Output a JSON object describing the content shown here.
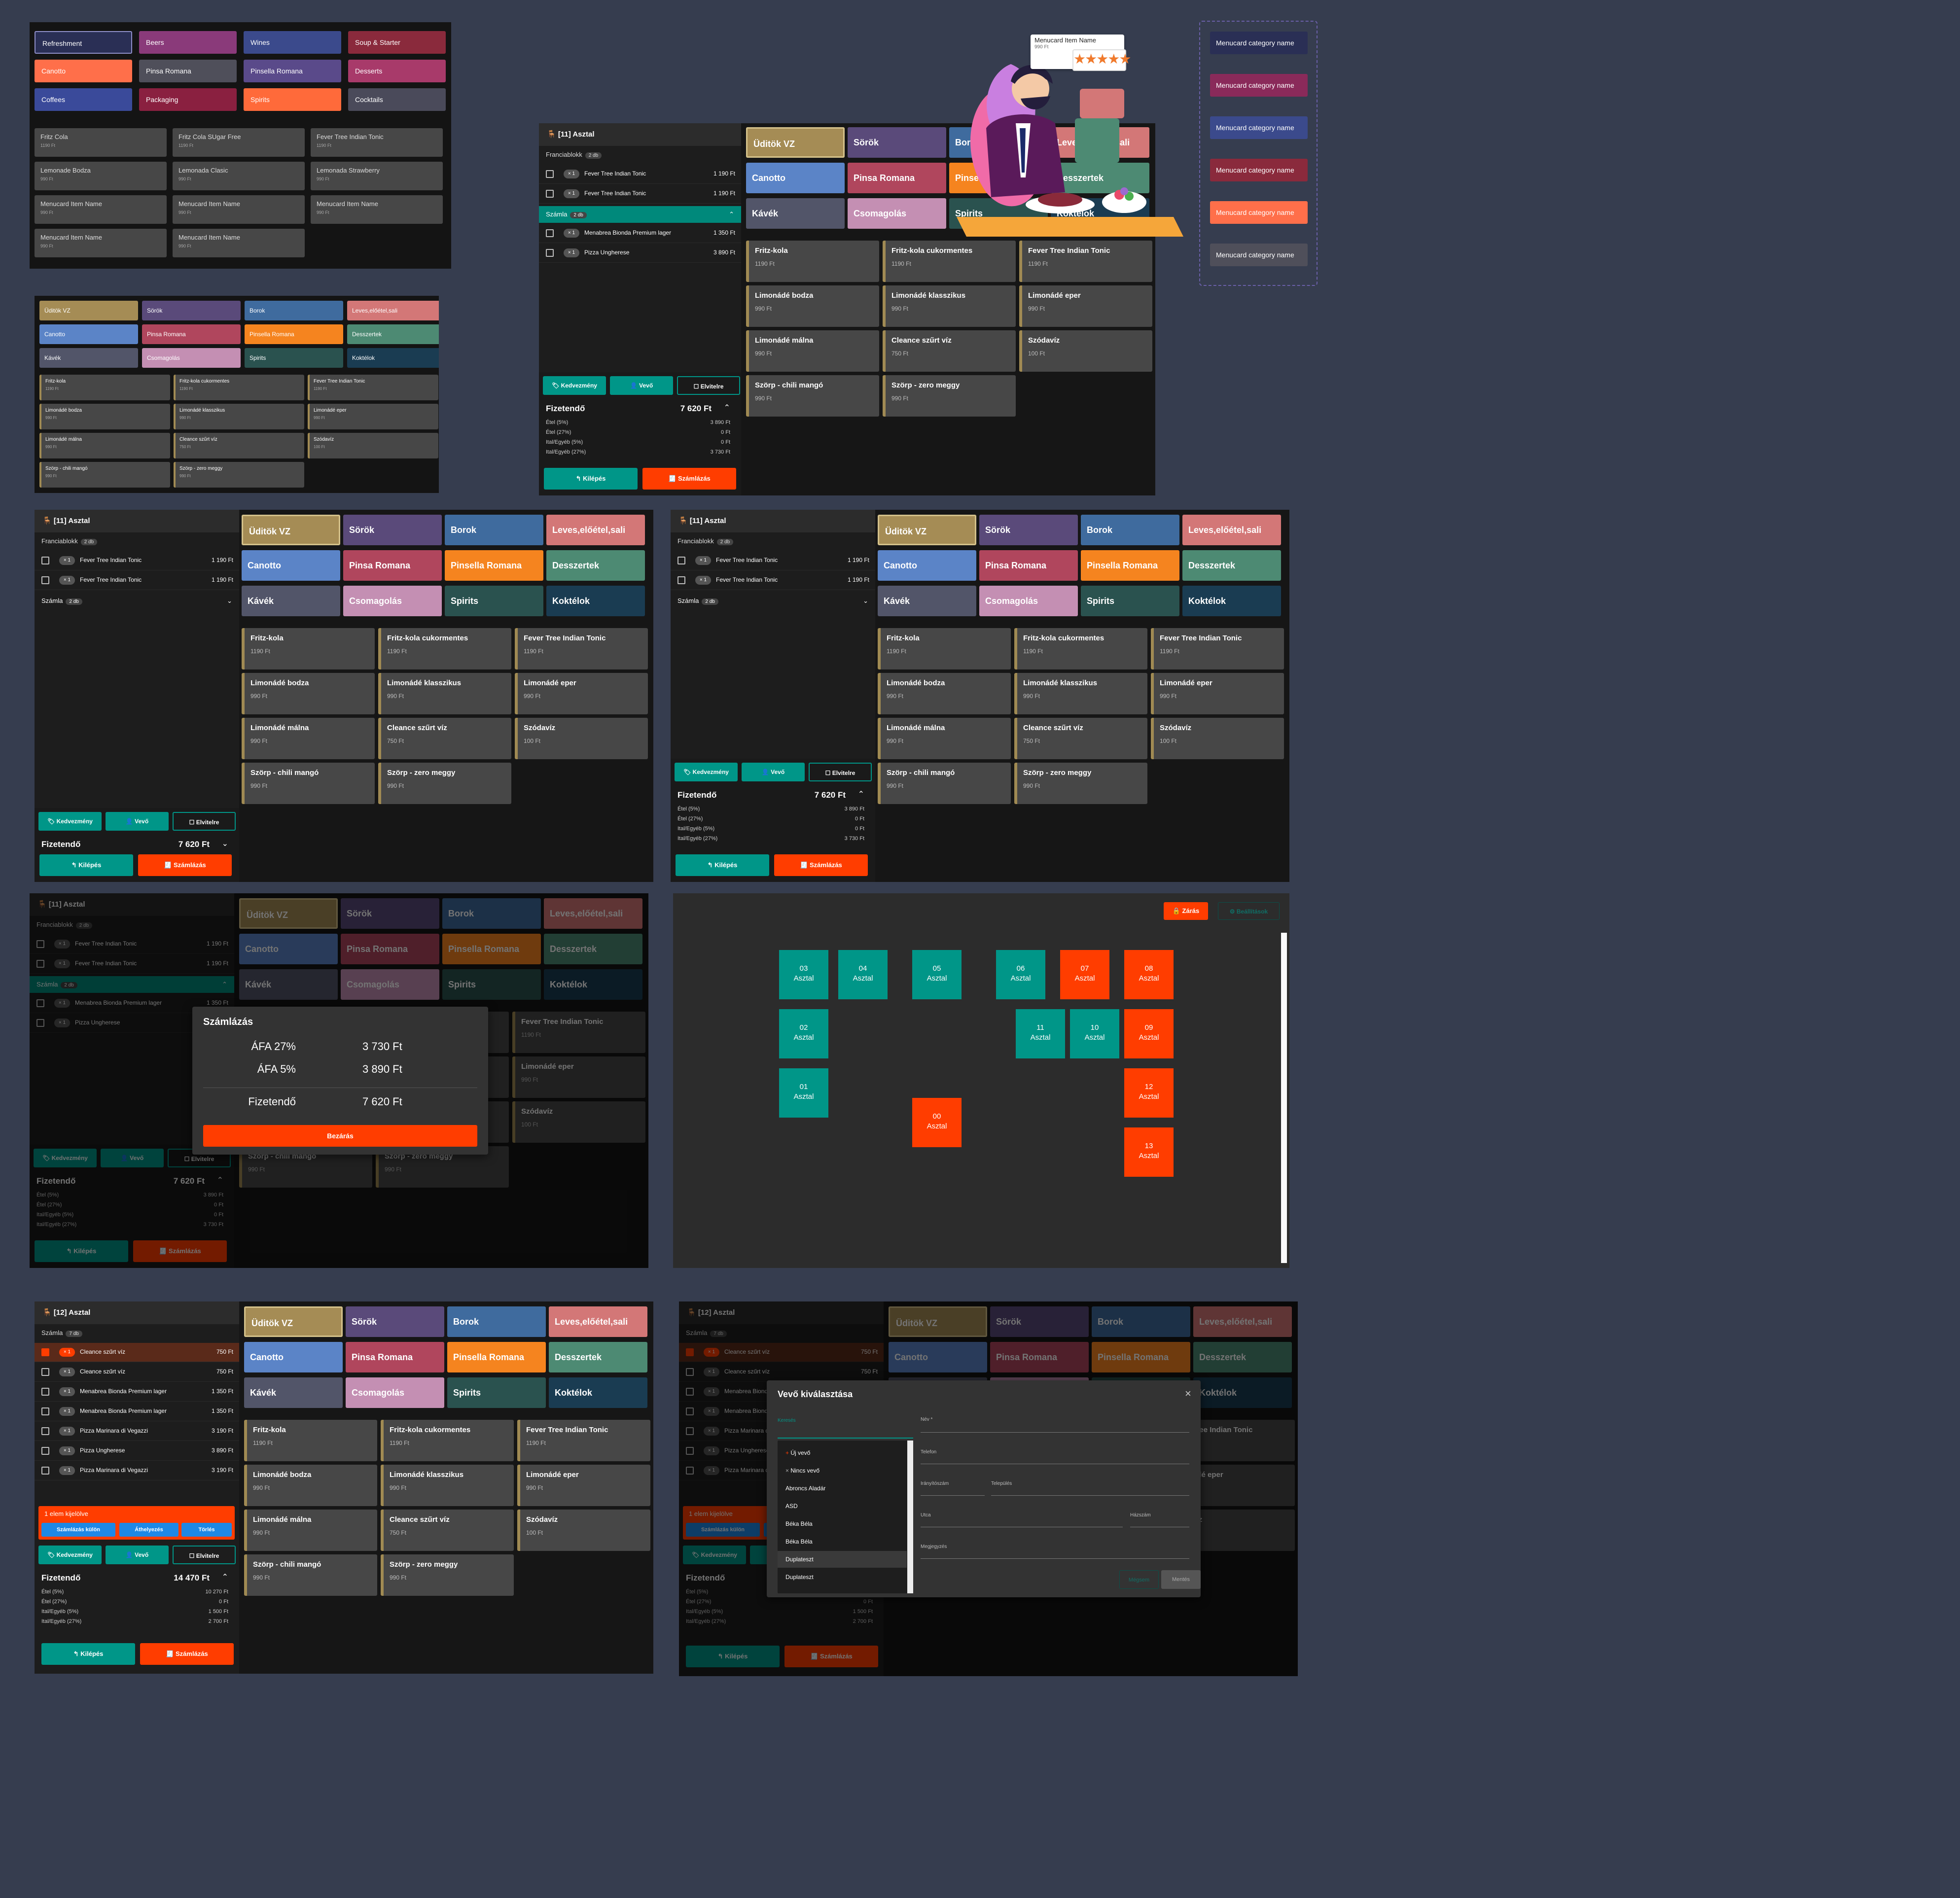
{
  "colors": {
    "teal": "#009688",
    "red": "#ff3d00",
    "background": "#363d4f",
    "panel": "#161616"
  },
  "icons": [
    "table-icon",
    "chevron-up-icon",
    "chevron-down-icon",
    "tag-icon",
    "person-icon",
    "box-icon",
    "logout-icon",
    "receipt-icon",
    "lock-icon",
    "gear-icon",
    "close-icon",
    "plus-icon",
    "star-icon"
  ],
  "p1": {
    "cats": [
      "Refreshment",
      "Beers",
      "Wines",
      "Soup & Starter",
      "Canotto",
      "Pinsa Romana",
      "Pinsella Romana",
      "Desserts",
      "Coffees",
      "Packaging",
      "Spirits",
      "Cocktails"
    ],
    "items": [
      {
        "name": "Fritz Cola",
        "price": "1190 Ft"
      },
      {
        "name": "Fritz Cola SUgar Free",
        "price": "1190 Ft"
      },
      {
        "name": "Fever Tree Indian Tonic",
        "price": "1190 Ft"
      },
      {
        "name": "Lemonade Bodza",
        "price": "990 Ft"
      },
      {
        "name": "Lemonada Clasic",
        "price": "990 Ft"
      },
      {
        "name": "Lemonada Strawberry",
        "price": "990 Ft"
      },
      {
        "name": "Menucard Item Name",
        "price": "990 Ft"
      },
      {
        "name": "Menucard Item Name",
        "price": "990 Ft"
      },
      {
        "name": "Menucard Item Name",
        "price": "990 Ft"
      },
      {
        "name": "Menucard Item Name",
        "price": "990 Ft"
      },
      {
        "name": "Menucard Item Name",
        "price": "990 Ft"
      }
    ]
  },
  "hu": {
    "cats": [
      "Üditök VZ",
      "Sörök",
      "Borok",
      "Leves,előétel,sali",
      "Canotto",
      "Pinsa Romana",
      "Pinsella Romana",
      "Desszertek",
      "Kávék",
      "Csomagolás",
      "Spirits",
      "Koktélok"
    ],
    "items": [
      {
        "name": "Fritz-kola",
        "price": "1190 Ft"
      },
      {
        "name": "Fritz-kola cukormentes",
        "price": "1190 Ft"
      },
      {
        "name": "Fever Tree Indian Tonic",
        "price": "1190 Ft"
      },
      {
        "name": "Limonádé bodza",
        "price": "990 Ft"
      },
      {
        "name": "Limonádé klasszikus",
        "price": "990 Ft"
      },
      {
        "name": "Limonádé eper",
        "price": "990 Ft"
      },
      {
        "name": "Limonádé málna",
        "price": "990 Ft"
      },
      {
        "name": "Cleance szűrt víz",
        "price": "750 Ft"
      },
      {
        "name": "Szódavíz",
        "price": "100 Ft"
      },
      {
        "name": "Szörp - chili mangó",
        "price": "990 Ft"
      },
      {
        "name": "Szörp - zero meggy",
        "price": "990 Ft"
      }
    ]
  },
  "catColors": [
    "#a58c55",
    "#5a4a7a",
    "#3f6b9e",
    "#d37777",
    "#5b84c7",
    "#b0465d",
    "#f5841f",
    "#4d8a73",
    "#525569",
    "#c48fb3",
    "#2a524f",
    "#1a3c52"
  ],
  "illustration": {
    "label": "Menucard Item Name",
    "price": "990 Ft"
  },
  "sideCats": [
    "Menucard category name",
    "Menucard category name",
    "Menucard category name",
    "Menucard category name",
    "Menucard category name",
    "Menucard category name"
  ],
  "order": {
    "title": "[11] Asztal",
    "group1": "Franciablokk",
    "group1_badge": "2 db",
    "group2": "Számla",
    "group2_badge": "2 db",
    "lines": [
      {
        "qty": "× 1",
        "name": "Fever Tree Indian Tonic",
        "price": "1 190 Ft"
      },
      {
        "qty": "× 1",
        "name": "Fever Tree Indian Tonic",
        "price": "1 190 Ft"
      }
    ],
    "lines2": [
      {
        "qty": "× 1",
        "name": "Menabrea Bionda Premium lager",
        "price": "1 350 Ft"
      },
      {
        "qty": "× 1",
        "name": "Pizza Ungherese",
        "price": "3 890 Ft"
      }
    ],
    "btn_discount": "Kedvezmény",
    "btn_customer": "Vevő",
    "btn_takeaway": "Elvitelre",
    "total_label": "Fizetendő",
    "total": "7 620 Ft",
    "tax": [
      {
        "label": "Étel (5%)",
        "value": "3 890 Ft"
      },
      {
        "label": "Étel (27%)",
        "value": "0 Ft"
      },
      {
        "label": "Ital/Egyéb (5%)",
        "value": "0 Ft"
      },
      {
        "label": "Ital/Egyéb (27%)",
        "value": "3 730 Ft"
      }
    ],
    "btn_exit": "Kilépés",
    "btn_invoice": "Számlázás"
  },
  "modal": {
    "title": "Számlázás",
    "vat27_label": "ÁFA 27%",
    "vat27": "3 730 Ft",
    "vat5_label": "ÁFA 5%",
    "vat5": "3 890 Ft",
    "total_label": "Fizetendő",
    "total": "7 620 Ft",
    "close": "Bezárás"
  },
  "floor": {
    "btn_close": "Zárás",
    "btn_settings": "Beállítások",
    "tables": [
      {
        "num": "03",
        "label": "Asztal",
        "color": "teal"
      },
      {
        "num": "04",
        "label": "Asztal",
        "color": "teal"
      },
      {
        "num": "05",
        "label": "Asztal",
        "color": "teal"
      },
      {
        "num": "06",
        "label": "Asztal",
        "color": "teal"
      },
      {
        "num": "07",
        "label": "Asztal",
        "color": "red"
      },
      {
        "num": "08",
        "label": "Asztal",
        "color": "red"
      },
      {
        "num": "02",
        "label": "Asztal",
        "color": "teal"
      },
      {
        "num": "11",
        "label": "Asztal",
        "color": "teal"
      },
      {
        "num": "10",
        "label": "Asztal",
        "color": "teal"
      },
      {
        "num": "09",
        "label": "Asztal",
        "color": "red"
      },
      {
        "num": "01",
        "label": "Asztal",
        "color": "teal"
      },
      {
        "num": "12",
        "label": "Asztal",
        "color": "red"
      },
      {
        "num": "00",
        "label": "Asztal",
        "color": "red"
      },
      {
        "num": "13",
        "label": "Asztal",
        "color": "red"
      }
    ]
  },
  "order12": {
    "title": "[12] Asztal",
    "group": "Számla",
    "badge": "7 db",
    "lines": [
      {
        "qty": "× 1",
        "name": "Cleance szűrt víz",
        "price": "750 Ft"
      },
      {
        "qty": "× 1",
        "name": "Cleance szűrt víz",
        "price": "750 Ft"
      },
      {
        "qty": "× 1",
        "name": "Menabrea Bionda Premium lager",
        "price": "1 350 Ft"
      },
      {
        "qty": "× 1",
        "name": "Menabrea Bionda Premium lager",
        "price": "1 350 Ft"
      },
      {
        "qty": "× 1",
        "name": "Pizza Marinara di Vegazzi",
        "price": "3 190 Ft"
      },
      {
        "qty": "× 1",
        "name": "Pizza Ungherese",
        "price": "3 890 Ft"
      },
      {
        "qty": "× 1",
        "name": "Pizza Marinara di Vegazzi",
        "price": "3 190 Ft"
      }
    ],
    "selected": "1 elem kijelölve",
    "sel_btn1": "Számlázás külön",
    "sel_btn2": "Áthelyezés",
    "sel_btn3": "Törlés",
    "total": "14 470 Ft",
    "tax": [
      {
        "label": "Étel (5%)",
        "value": "10 270 Ft"
      },
      {
        "label": "Étel (27%)",
        "value": "0 Ft"
      },
      {
        "label": "Ital/Egyéb (5%)",
        "value": "1 500 Ft"
      },
      {
        "label": "Ital/Egyéb (27%)",
        "value": "2 700 Ft"
      }
    ]
  },
  "customerModal": {
    "title": "Vevő kiválasztása",
    "search_label": "Keresés",
    "options": [
      "Új vevő",
      "Nincs vevő",
      "Abroncs Aladár",
      "ASD",
      "Béka Béla",
      "Béka Béla",
      "Duplateszt",
      "Duplateszt"
    ],
    "name_label": "Név *",
    "phone_label": "Telefon",
    "zip_label": "Irányítószám",
    "city_label": "Település",
    "street_label": "Utca",
    "house_label": "Házszám",
    "note_label": "Megjegyzés",
    "save": "Mégsem",
    "cancel": "Mentés"
  }
}
